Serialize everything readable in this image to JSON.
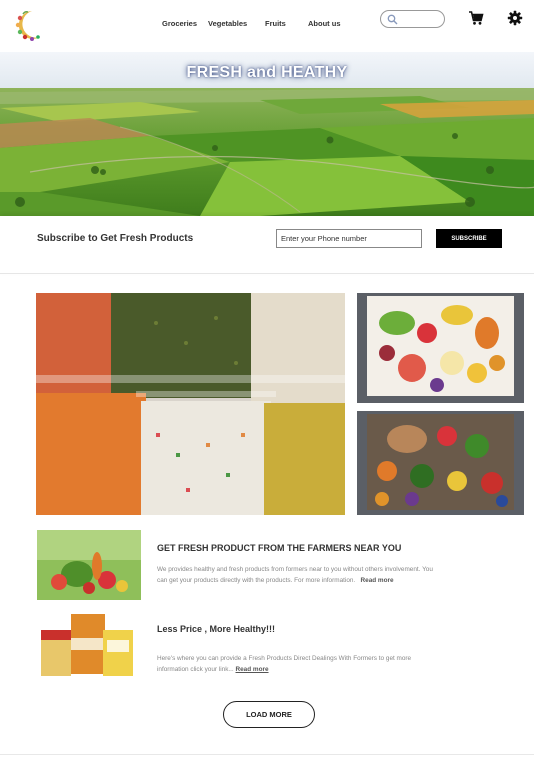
{
  "nav": {
    "items": [
      "Groceries",
      "Vegetables",
      "Fruits",
      "About us"
    ]
  },
  "search": {
    "placeholder": ""
  },
  "icons": {
    "search": "search-icon",
    "cart": "cart-icon",
    "settings": "gear-icon",
    "logo": "crescent-logo"
  },
  "hero": {
    "title": "FRESH and HEATHY"
  },
  "subscribe": {
    "text": "Subscribe to Get Fresh Products",
    "phone_placeholder": "Enter your Phone number",
    "button_label": "SUBSCRIBE"
  },
  "features": [
    {
      "title": "GET FRESH PRODUCT FROM THE FARMERS NEAR YOU",
      "description": "We provides healthy and fresh products from formers near to you without others involvement. You can get your products directly with the products. For more information.",
      "link": "Read more"
    },
    {
      "title": "Less Price , More Healthy!!!",
      "description": "Here's where you can provide a Fresh Products Direct Dealings With Formers to get more information click your link...",
      "link": "Read more"
    }
  ],
  "load_more_label": "LOAD MORE",
  "colors": {
    "accent": "#000000",
    "text": "#333333",
    "muted": "#888888"
  }
}
